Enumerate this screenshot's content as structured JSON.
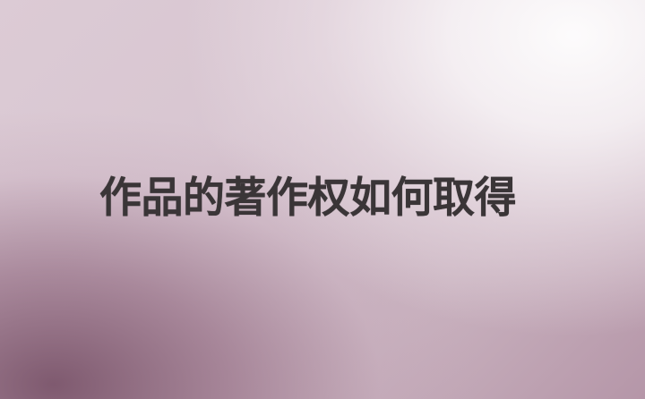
{
  "banner": {
    "headline": "作品的著作权如何取得"
  },
  "colors": {
    "text": "#3a3537",
    "background_light": "#fbf9fa",
    "background_dark": "#7a546a"
  }
}
